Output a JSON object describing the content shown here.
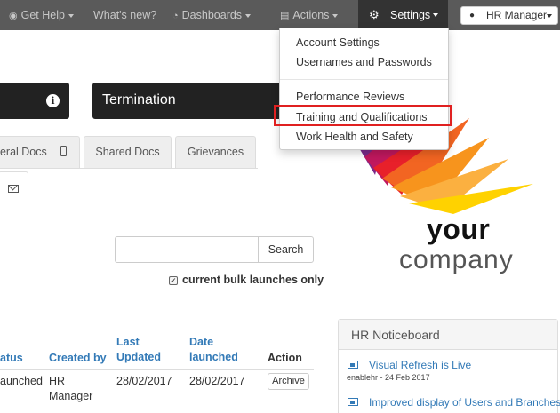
{
  "navbar": {
    "get_help": "Get Help",
    "whats_new": "What's new?",
    "dashboards": "Dashboards",
    "actions": "Actions",
    "settings": "Settings",
    "user": "HR Manager"
  },
  "settings_menu": {
    "items": [
      "Account Settings",
      "Usernames and Passwords",
      "Performance Reviews",
      "Training and Qualifications",
      "Work Health and Safety"
    ],
    "highlighted_index": 3
  },
  "panels": {
    "termination": "Termination"
  },
  "tabs": [
    "neral Docs",
    "Shared Docs",
    "Grievances"
  ],
  "search": {
    "placeholder": "",
    "button": "Search",
    "bulk_label": "current bulk launches only",
    "bulk_checked": true
  },
  "table": {
    "headers": {
      "status": "atus",
      "created_by": "Created by",
      "last_updated_1": "Last",
      "last_updated_2": "Updated",
      "date_launched_1": "Date",
      "date_launched_2": "launched",
      "action": "Action"
    },
    "row": {
      "status": "aunched",
      "created_by_1": "HR",
      "created_by_2": "Manager",
      "last_updated": "28/02/2017",
      "date_launched": "28/02/2017",
      "action": "Archive"
    }
  },
  "logo": {
    "word1": "your",
    "word2": "company",
    "colors": [
      "#7b2a8a",
      "#c0185e",
      "#e8202a",
      "#f26522",
      "#f7941d",
      "#fbb040",
      "#ffd200",
      "#fff200"
    ]
  },
  "noticeboard": {
    "title": "HR Noticeboard",
    "items": [
      {
        "title": "Visual Refresh is Live",
        "meta": "enablehr - 24 Feb 2017"
      },
      {
        "title": "Improved display of Users and Branches",
        "meta": ""
      }
    ]
  },
  "colors": {
    "navbar": "#5a5a5a",
    "link": "#337ab7",
    "highlight": "#e02020"
  }
}
